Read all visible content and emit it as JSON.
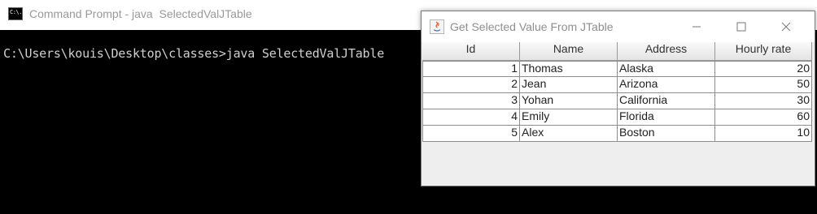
{
  "cmd": {
    "icon_text": "C:\\.",
    "title": "Command Prompt - java  SelectedValJTable",
    "line": "C:\\Users\\kouis\\Desktop\\classes>java SelectedValJTable"
  },
  "jframe": {
    "title": "Get Selected Value From JTable",
    "table": {
      "headers": [
        "Id",
        "Name",
        "Address",
        "Hourly rate"
      ],
      "rows": [
        [
          "1",
          "Thomas",
          "Alaska",
          "20"
        ],
        [
          "2",
          "Jean",
          "Arizona",
          "50"
        ],
        [
          "3",
          "Yohan",
          "California",
          "30"
        ],
        [
          "4",
          "Emily",
          "Florida",
          "60"
        ],
        [
          "5",
          "Alex",
          "Boston",
          "10"
        ]
      ]
    }
  },
  "colors": {
    "console_bg": "#000000",
    "console_text": "#cfcfcf",
    "title_text_inactive": "#999999"
  },
  "icons": [
    "cmd-icon",
    "java-icon",
    "minimize-icon",
    "maximize-icon",
    "close-icon"
  ]
}
